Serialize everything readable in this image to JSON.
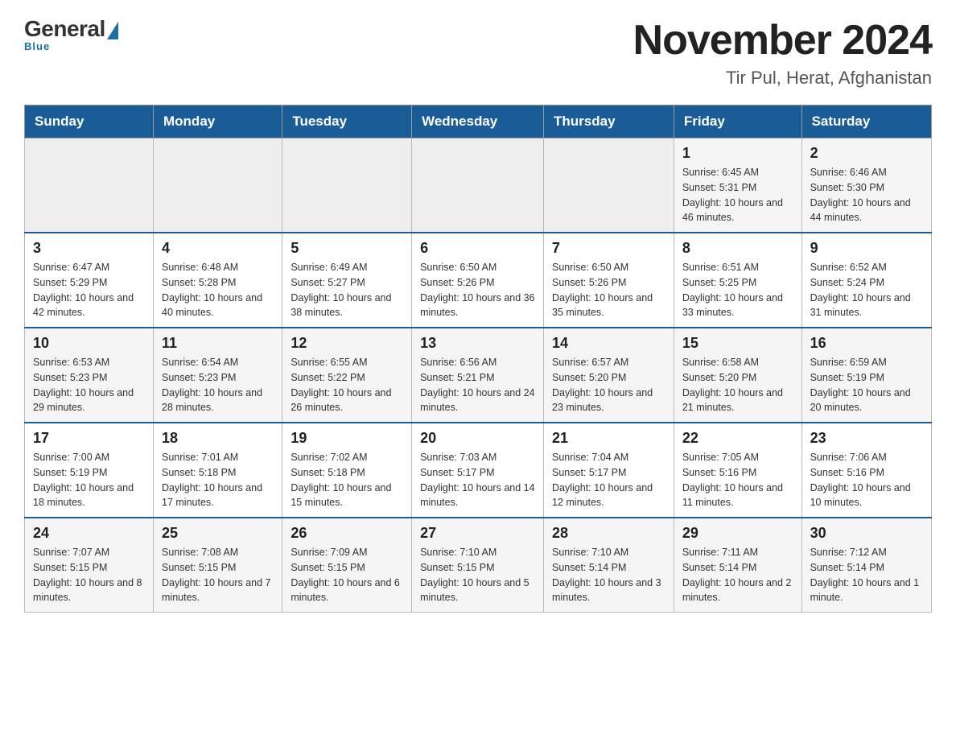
{
  "logo": {
    "general": "General",
    "blue": "Blue",
    "subtitle": "Blue"
  },
  "header": {
    "title": "November 2024",
    "location": "Tir Pul, Herat, Afghanistan"
  },
  "days_of_week": [
    "Sunday",
    "Monday",
    "Tuesday",
    "Wednesday",
    "Thursday",
    "Friday",
    "Saturday"
  ],
  "weeks": [
    [
      {
        "day": "",
        "sunrise": "",
        "sunset": "",
        "daylight": ""
      },
      {
        "day": "",
        "sunrise": "",
        "sunset": "",
        "daylight": ""
      },
      {
        "day": "",
        "sunrise": "",
        "sunset": "",
        "daylight": ""
      },
      {
        "day": "",
        "sunrise": "",
        "sunset": "",
        "daylight": ""
      },
      {
        "day": "",
        "sunrise": "",
        "sunset": "",
        "daylight": ""
      },
      {
        "day": "1",
        "sunrise": "Sunrise: 6:45 AM",
        "sunset": "Sunset: 5:31 PM",
        "daylight": "Daylight: 10 hours and 46 minutes."
      },
      {
        "day": "2",
        "sunrise": "Sunrise: 6:46 AM",
        "sunset": "Sunset: 5:30 PM",
        "daylight": "Daylight: 10 hours and 44 minutes."
      }
    ],
    [
      {
        "day": "3",
        "sunrise": "Sunrise: 6:47 AM",
        "sunset": "Sunset: 5:29 PM",
        "daylight": "Daylight: 10 hours and 42 minutes."
      },
      {
        "day": "4",
        "sunrise": "Sunrise: 6:48 AM",
        "sunset": "Sunset: 5:28 PM",
        "daylight": "Daylight: 10 hours and 40 minutes."
      },
      {
        "day": "5",
        "sunrise": "Sunrise: 6:49 AM",
        "sunset": "Sunset: 5:27 PM",
        "daylight": "Daylight: 10 hours and 38 minutes."
      },
      {
        "day": "6",
        "sunrise": "Sunrise: 6:50 AM",
        "sunset": "Sunset: 5:26 PM",
        "daylight": "Daylight: 10 hours and 36 minutes."
      },
      {
        "day": "7",
        "sunrise": "Sunrise: 6:50 AM",
        "sunset": "Sunset: 5:26 PM",
        "daylight": "Daylight: 10 hours and 35 minutes."
      },
      {
        "day": "8",
        "sunrise": "Sunrise: 6:51 AM",
        "sunset": "Sunset: 5:25 PM",
        "daylight": "Daylight: 10 hours and 33 minutes."
      },
      {
        "day": "9",
        "sunrise": "Sunrise: 6:52 AM",
        "sunset": "Sunset: 5:24 PM",
        "daylight": "Daylight: 10 hours and 31 minutes."
      }
    ],
    [
      {
        "day": "10",
        "sunrise": "Sunrise: 6:53 AM",
        "sunset": "Sunset: 5:23 PM",
        "daylight": "Daylight: 10 hours and 29 minutes."
      },
      {
        "day": "11",
        "sunrise": "Sunrise: 6:54 AM",
        "sunset": "Sunset: 5:23 PM",
        "daylight": "Daylight: 10 hours and 28 minutes."
      },
      {
        "day": "12",
        "sunrise": "Sunrise: 6:55 AM",
        "sunset": "Sunset: 5:22 PM",
        "daylight": "Daylight: 10 hours and 26 minutes."
      },
      {
        "day": "13",
        "sunrise": "Sunrise: 6:56 AM",
        "sunset": "Sunset: 5:21 PM",
        "daylight": "Daylight: 10 hours and 24 minutes."
      },
      {
        "day": "14",
        "sunrise": "Sunrise: 6:57 AM",
        "sunset": "Sunset: 5:20 PM",
        "daylight": "Daylight: 10 hours and 23 minutes."
      },
      {
        "day": "15",
        "sunrise": "Sunrise: 6:58 AM",
        "sunset": "Sunset: 5:20 PM",
        "daylight": "Daylight: 10 hours and 21 minutes."
      },
      {
        "day": "16",
        "sunrise": "Sunrise: 6:59 AM",
        "sunset": "Sunset: 5:19 PM",
        "daylight": "Daylight: 10 hours and 20 minutes."
      }
    ],
    [
      {
        "day": "17",
        "sunrise": "Sunrise: 7:00 AM",
        "sunset": "Sunset: 5:19 PM",
        "daylight": "Daylight: 10 hours and 18 minutes."
      },
      {
        "day": "18",
        "sunrise": "Sunrise: 7:01 AM",
        "sunset": "Sunset: 5:18 PM",
        "daylight": "Daylight: 10 hours and 17 minutes."
      },
      {
        "day": "19",
        "sunrise": "Sunrise: 7:02 AM",
        "sunset": "Sunset: 5:18 PM",
        "daylight": "Daylight: 10 hours and 15 minutes."
      },
      {
        "day": "20",
        "sunrise": "Sunrise: 7:03 AM",
        "sunset": "Sunset: 5:17 PM",
        "daylight": "Daylight: 10 hours and 14 minutes."
      },
      {
        "day": "21",
        "sunrise": "Sunrise: 7:04 AM",
        "sunset": "Sunset: 5:17 PM",
        "daylight": "Daylight: 10 hours and 12 minutes."
      },
      {
        "day": "22",
        "sunrise": "Sunrise: 7:05 AM",
        "sunset": "Sunset: 5:16 PM",
        "daylight": "Daylight: 10 hours and 11 minutes."
      },
      {
        "day": "23",
        "sunrise": "Sunrise: 7:06 AM",
        "sunset": "Sunset: 5:16 PM",
        "daylight": "Daylight: 10 hours and 10 minutes."
      }
    ],
    [
      {
        "day": "24",
        "sunrise": "Sunrise: 7:07 AM",
        "sunset": "Sunset: 5:15 PM",
        "daylight": "Daylight: 10 hours and 8 minutes."
      },
      {
        "day": "25",
        "sunrise": "Sunrise: 7:08 AM",
        "sunset": "Sunset: 5:15 PM",
        "daylight": "Daylight: 10 hours and 7 minutes."
      },
      {
        "day": "26",
        "sunrise": "Sunrise: 7:09 AM",
        "sunset": "Sunset: 5:15 PM",
        "daylight": "Daylight: 10 hours and 6 minutes."
      },
      {
        "day": "27",
        "sunrise": "Sunrise: 7:10 AM",
        "sunset": "Sunset: 5:15 PM",
        "daylight": "Daylight: 10 hours and 5 minutes."
      },
      {
        "day": "28",
        "sunrise": "Sunrise: 7:10 AM",
        "sunset": "Sunset: 5:14 PM",
        "daylight": "Daylight: 10 hours and 3 minutes."
      },
      {
        "day": "29",
        "sunrise": "Sunrise: 7:11 AM",
        "sunset": "Sunset: 5:14 PM",
        "daylight": "Daylight: 10 hours and 2 minutes."
      },
      {
        "day": "30",
        "sunrise": "Sunrise: 7:12 AM",
        "sunset": "Sunset: 5:14 PM",
        "daylight": "Daylight: 10 hours and 1 minute."
      }
    ]
  ]
}
